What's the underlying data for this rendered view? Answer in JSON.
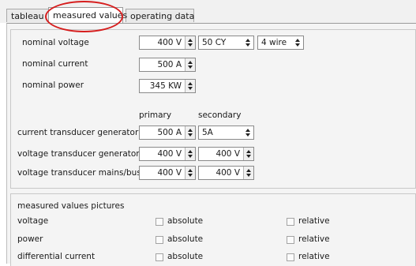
{
  "tabs": [
    {
      "label": "tableau"
    },
    {
      "label": "measured values"
    },
    {
      "label": "operating data"
    }
  ],
  "nominal": {
    "voltage": {
      "label": "nominal voltage",
      "value": "400 V",
      "frequency": "50 CY",
      "wiring": "4 wire"
    },
    "current": {
      "label": "nominal current",
      "value": "500 A"
    },
    "power": {
      "label": "nominal power",
      "value": "345 KW"
    }
  },
  "transducers": {
    "primary_header": "primary",
    "secondary_header": "secondary",
    "rows": [
      {
        "label": "current transducer generator",
        "primary": "500 A",
        "secondary": "5A"
      },
      {
        "label": "voltage transducer generator",
        "primary": "400 V",
        "secondary": "400 V"
      },
      {
        "label": "voltage transducer mains/busbar",
        "primary": "400 V",
        "secondary": "400 V"
      }
    ]
  },
  "pictures": {
    "title": "measured values pictures",
    "absolute_label": "absolute",
    "relative_label": "relative",
    "rows": [
      {
        "label": "voltage",
        "absolute": false,
        "relative": false
      },
      {
        "label": "power",
        "absolute": false,
        "relative": false
      },
      {
        "label": "differential current",
        "absolute": false,
        "relative": false
      }
    ]
  },
  "colors": {
    "highlight": "#d61d1d",
    "panel": "#f4f4f4",
    "tabbar": "#f1f1f1"
  }
}
